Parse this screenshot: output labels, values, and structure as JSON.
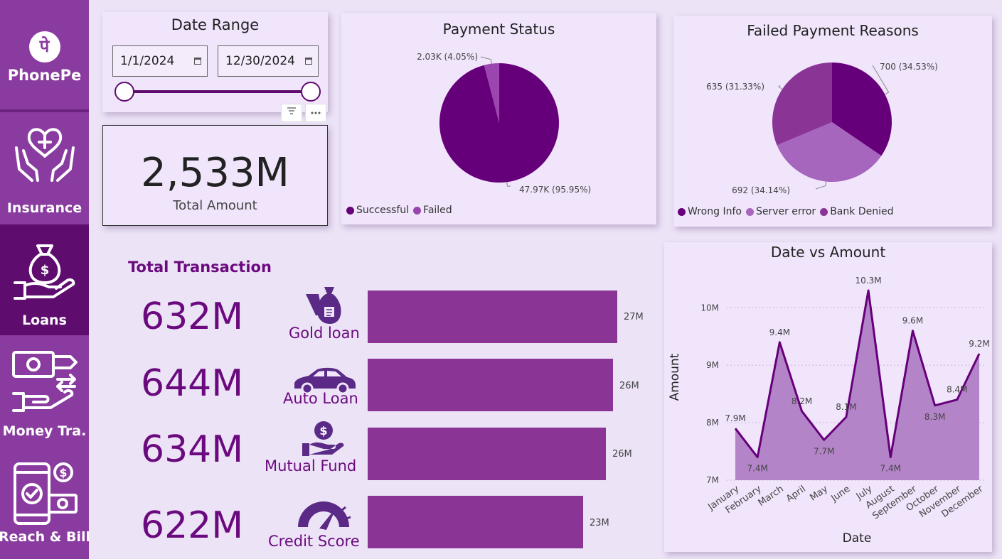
{
  "sidebar": {
    "brand": "PhonePe",
    "brand_mark": "पे",
    "items": [
      {
        "label": "Insurance",
        "icon": "insurance-hands-heart-icon"
      },
      {
        "label": "Loans",
        "icon": "money-bag-hand-icon"
      },
      {
        "label": "Money Tra.",
        "icon": "money-transfer-icon"
      },
      {
        "label": "Reach & Bill",
        "icon": "phone-bill-payment-icon"
      }
    ]
  },
  "date_range": {
    "title": "Date Range",
    "start": "1/1/2024",
    "end": "12/30/2024"
  },
  "total_amount": {
    "value": "2,533M",
    "label": "Total Amount"
  },
  "total_transaction": {
    "title": "Total Transaction",
    "rows": [
      {
        "value": "632M",
        "label": "Gold loan",
        "icon": "gold-loan-bag-icon"
      },
      {
        "value": "644M",
        "label": "Auto Loan",
        "icon": "car-icon"
      },
      {
        "value": "634M",
        "label": "Mutual Fund",
        "icon": "coin-hand-icon"
      },
      {
        "value": "622M",
        "label": "Credit Score",
        "icon": "gauge-icon"
      }
    ]
  },
  "colors": {
    "primary_dark": "#5e0c6e",
    "sidebar": "#8a3ba0",
    "bar": "#8a3596",
    "background": "#ece3f7"
  },
  "chart_data": [
    {
      "type": "pie",
      "title": "Payment Status",
      "labels": [
        "Successful",
        "Failed"
      ],
      "values": [
        47.97,
        2.03
      ],
      "data_labels": [
        "47.97K (95.95%)",
        "2.03K (4.05%)"
      ],
      "colors": [
        "#66007a",
        "#9b45ae"
      ],
      "legend": "bottom-left"
    },
    {
      "type": "pie",
      "title": "Failed Payment Reasons",
      "labels": [
        "Wrong Info",
        "Server error",
        "Bank Denied"
      ],
      "values": [
        700,
        692,
        635
      ],
      "data_labels": [
        "700 (34.53%)",
        "692 (34.14%)",
        "635 (31.33%)"
      ],
      "colors": [
        "#66007a",
        "#a666bd",
        "#8a3596"
      ],
      "legend": "bottom-left"
    },
    {
      "type": "bar",
      "orientation": "horizontal",
      "categories": [
        "Gold loan",
        "Auto Loan",
        "Mutual Fund",
        "Credit Score"
      ],
      "values": [
        27,
        26,
        26,
        23
      ],
      "data_labels": [
        "27M",
        "26M",
        "26M",
        "23M"
      ]
    },
    {
      "type": "area",
      "title": "Date vs Amount",
      "xlabel": "Date",
      "ylabel": "Amount",
      "x": [
        "January",
        "February",
        "March",
        "April",
        "May",
        "June",
        "July",
        "August",
        "September",
        "October",
        "November",
        "December"
      ],
      "values": [
        7.9,
        7.4,
        9.4,
        8.2,
        7.7,
        8.1,
        10.3,
        7.4,
        9.6,
        8.3,
        8.4,
        9.2
      ],
      "data_labels": [
        "7.9M",
        "7.4M",
        "9.4M",
        "8.2M",
        "7.7M",
        "8.1M",
        "10.3M",
        "7.4M",
        "9.6M",
        "8.3M",
        "8.4M",
        "9.2M"
      ],
      "yticks": [
        "7M",
        "8M",
        "9M",
        "10M"
      ],
      "ylim": [
        7,
        10.3
      ],
      "grid": true
    }
  ]
}
